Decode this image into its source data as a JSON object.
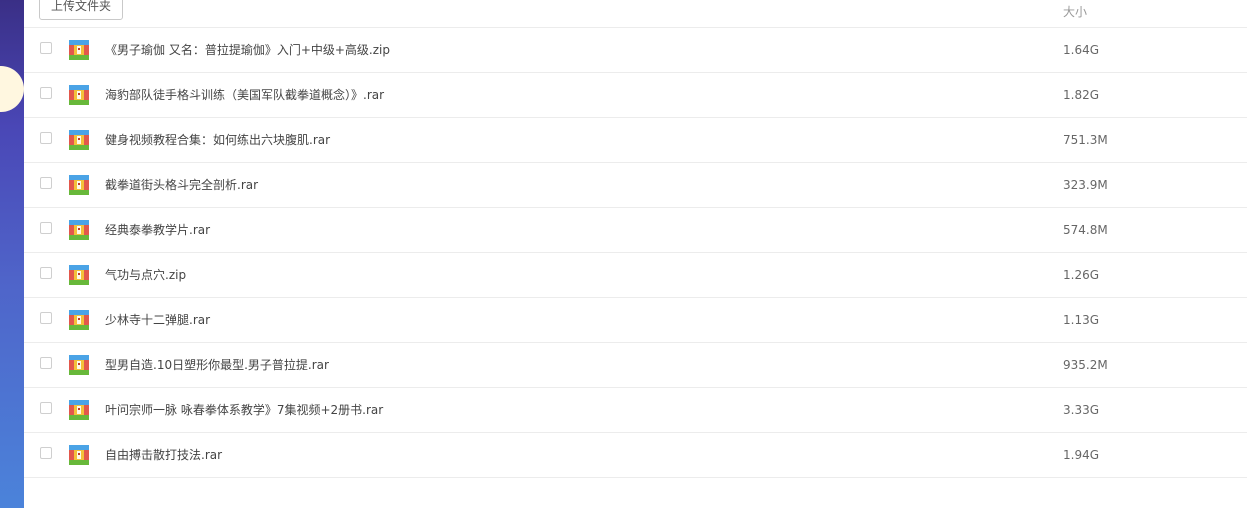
{
  "toolbar": {
    "upload_folder_label": "上传文件夹"
  },
  "columns": {
    "size_header": "大小"
  },
  "files": [
    {
      "name": "《男子瑜伽 又名：普拉提瑜伽》入门+中级+高级.zip",
      "size": "1.64G",
      "icon": "archive-icon"
    },
    {
      "name": "海豹部队徒手格斗训练（美国军队截拳道概念）》.rar",
      "size": "1.82G",
      "icon": "archive-icon"
    },
    {
      "name": "健身视频教程合集：如何练出六块腹肌.rar",
      "size": "751.3M",
      "icon": "archive-icon"
    },
    {
      "name": "截拳道街头格斗完全剖析.rar",
      "size": "323.9M",
      "icon": "archive-icon"
    },
    {
      "name": "经典泰拳教学片.rar",
      "size": "574.8M",
      "icon": "archive-icon"
    },
    {
      "name": "气功与点穴.zip",
      "size": "1.26G",
      "icon": "archive-icon"
    },
    {
      "name": "少林寺十二弹腿.rar",
      "size": "1.13G",
      "icon": "archive-icon"
    },
    {
      "name": "型男自造.10日塑形你最型.男子普拉提.rar",
      "size": "935.2M",
      "icon": "archive-icon"
    },
    {
      "name": "叶问宗师一脉 咏春拳体系教学》7集视频+2册书.rar",
      "size": "3.33G",
      "icon": "archive-icon"
    },
    {
      "name": "自由搏击散打技法.rar",
      "size": "1.94G",
      "icon": "archive-icon"
    }
  ],
  "colors": {
    "sidebar_top": "#3a2f86",
    "sidebar_bottom": "#4b83da",
    "divider": "#ececec"
  }
}
